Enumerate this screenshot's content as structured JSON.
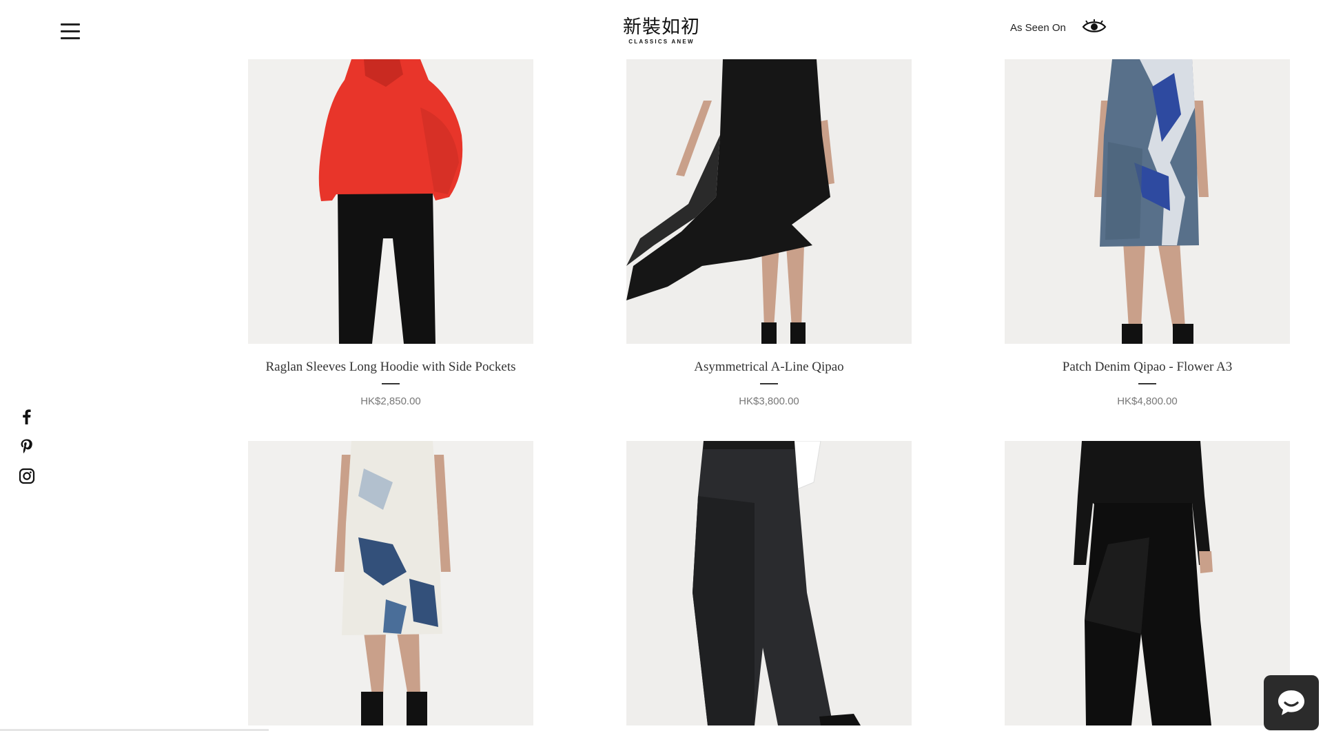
{
  "header": {
    "logo_cn": "新裝如初",
    "logo_en": "CLASSICS ANEW",
    "as_seen_on": "As Seen On"
  },
  "social": [
    "facebook-icon",
    "pinterest-icon",
    "instagram-icon"
  ],
  "products": [
    {
      "name": "Raglan Sleeves Long Hoodie with Side Pockets",
      "price": "HK$2,850.00"
    },
    {
      "name": "Asymmetrical A-Line Qipao",
      "price": "HK$3,800.00"
    },
    {
      "name": "Patch Denim Qipao - Flower A3",
      "price": "HK$4,800.00"
    },
    {
      "name": "",
      "price": ""
    },
    {
      "name": "",
      "price": ""
    },
    {
      "name": "",
      "price": ""
    }
  ],
  "colors": {
    "background": "#ffffff",
    "image_bg": "#f0efed",
    "text": "#333333",
    "price": "#777777",
    "chat_bg": "#2b2b2b",
    "hoodie_red": "#e8352a"
  }
}
